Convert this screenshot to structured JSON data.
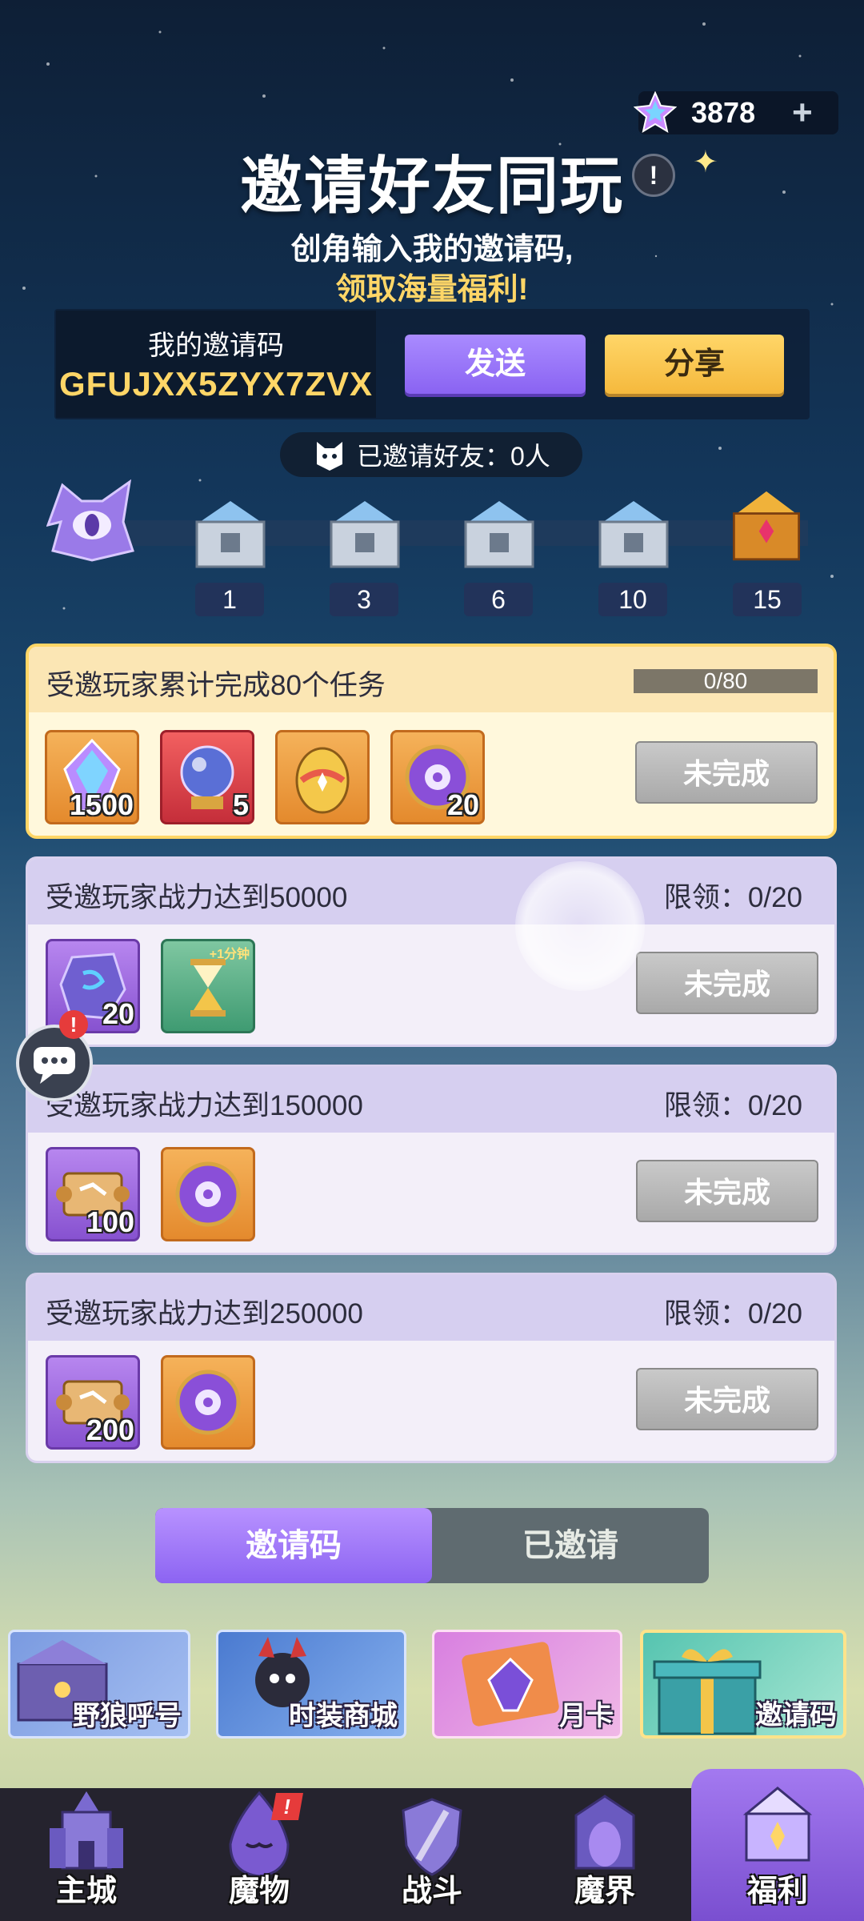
{
  "currency": {
    "value": "3878",
    "plus_icon": "plus-icon",
    "gem_icon": "star-gem-icon"
  },
  "header": {
    "title": "邀请好友同玩",
    "info_icon": "!",
    "subtitle_line1": "创角输入我的邀请码,",
    "subtitle_line2": "领取海量福利!"
  },
  "invite_code": {
    "label": "我的邀请码",
    "value": "GFUJXX5ZYX7ZVX",
    "send_label": "发送",
    "share_label": "分享"
  },
  "invited": {
    "text": "已邀请好友：0人"
  },
  "milestones": [
    {
      "count": "1",
      "chest": "silver"
    },
    {
      "count": "3",
      "chest": "silver"
    },
    {
      "count": "6",
      "chest": "silver"
    },
    {
      "count": "10",
      "chest": "silver"
    },
    {
      "count": "15",
      "chest": "gold"
    }
  ],
  "tasks": [
    {
      "title": "受邀玩家累计完成80个任务",
      "progress": "0/80",
      "button": "未完成",
      "rewards": [
        {
          "count": "1500",
          "icon": "star-crystal-icon"
        },
        {
          "count": "5",
          "icon": "orb-icon"
        },
        {
          "count": "",
          "icon": "egg-icon"
        },
        {
          "count": "20",
          "icon": "purple-emblem-icon"
        }
      ]
    },
    {
      "title": "受邀玩家战力达到50000",
      "limit": "限领：0/20",
      "button": "未完成",
      "rewards": [
        {
          "count": "20",
          "icon": "rune-stone-icon"
        },
        {
          "count": "",
          "icon": "hourglass-icon",
          "tag": "+1分钟"
        }
      ]
    },
    {
      "title": "受邀玩家战力达到150000",
      "limit": "限领：0/20",
      "button": "未完成",
      "rewards": [
        {
          "count": "100",
          "icon": "scroll-icon"
        },
        {
          "count": "",
          "icon": "purple-emblem-icon"
        }
      ]
    },
    {
      "title": "受邀玩家战力达到250000",
      "limit": "限领：0/20",
      "button": "未完成",
      "rewards": [
        {
          "count": "200",
          "icon": "scroll-icon"
        },
        {
          "count": "",
          "icon": "purple-emblem-icon"
        }
      ]
    }
  ],
  "tabs": [
    {
      "label": "邀请码",
      "active": true
    },
    {
      "label": "已邀请",
      "active": false
    }
  ],
  "features": [
    {
      "label": "野狼呼号"
    },
    {
      "label": "时装商城"
    },
    {
      "label": "月卡"
    },
    {
      "label": "邀请码"
    }
  ],
  "nav": [
    {
      "label": "主城"
    },
    {
      "label": "魔物",
      "alert": "!"
    },
    {
      "label": "战斗"
    },
    {
      "label": "魔界"
    },
    {
      "label": "福利",
      "active": true
    }
  ]
}
